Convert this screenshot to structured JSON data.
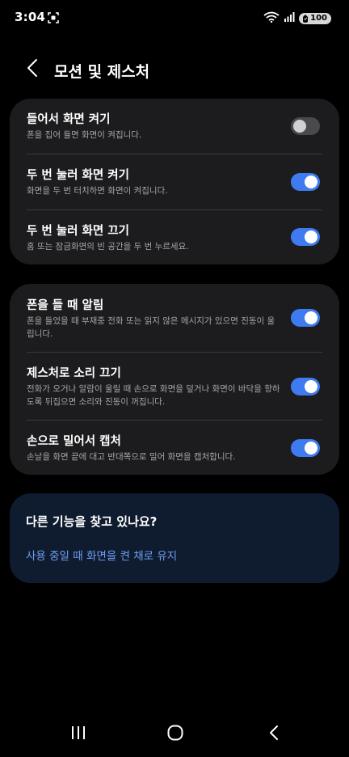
{
  "status_bar": {
    "time": "3:04",
    "battery": "100",
    "left_icon": "screen-recording-icon",
    "right_icons": [
      "wifi-icon",
      "signal-icon",
      "battery-icon"
    ]
  },
  "header": {
    "back_icon": "chevron-left-icon",
    "title": "모션 및 제스처"
  },
  "card1": {
    "items": [
      {
        "title": "들어서 화면 켜기",
        "desc": "폰을 집어 들면 화면이 켜집니다.",
        "enabled": false
      },
      {
        "title": "두 번 눌러 화면 켜기",
        "desc": "화면을 두 번 터치하면 화면이 켜집니다.",
        "enabled": true
      },
      {
        "title": "두 번 눌러 화면 끄기",
        "desc": "홈 또는 잠금화면의 빈 공간을 두 번 누르세요.",
        "enabled": true
      }
    ]
  },
  "card2": {
    "items": [
      {
        "title": "폰을 들 때 알림",
        "desc": "폰을 들었을 때 부재중 전화 또는 읽지 않은 메시지가 있으면 진동이 울립니다.",
        "enabled": true
      },
      {
        "title": "제스처로 소리 끄기",
        "desc": "전화가 오거나 알람이 울릴 때 손으로 화면을 덮거나 화면이 바닥을 향하도록 뒤집으면 소리와 진동이 꺼집니다.",
        "enabled": true
      },
      {
        "title": "손으로 밀어서 캡처",
        "desc": "손날을 화면 끝에 대고 반대쪽으로 밀어 화면을 캡처합니다.",
        "enabled": true
      }
    ]
  },
  "suggestions": {
    "title": "다른 기능을 찾고 있나요?",
    "link": "사용 중일 때 화면을 켠 채로 유지"
  },
  "nav_bar": {
    "icons": [
      "recent-apps-icon",
      "home-icon",
      "back-icon"
    ]
  },
  "colors": {
    "background": "#000000",
    "card": "#1c1c1e",
    "accent": "#3e7bf0",
    "link": "#6f9cf2",
    "suggest_card": "#0f1c2f"
  }
}
